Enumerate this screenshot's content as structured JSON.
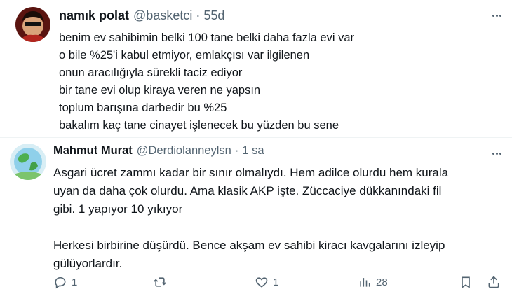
{
  "tweet1": {
    "name": "namık polat",
    "handle": "@basketci",
    "separator": "·",
    "time": "55d",
    "lines": [
      "benim ev sahibimin belki 100 tane belki daha fazla evi var",
      "o bile %25'i kabul etmiyor, emlakçısı var ilgilenen",
      "onun aracılığıyla sürekli taciz ediyor",
      "bir tane evi olup kiraya veren ne yapsın",
      "toplum barışına darbedir bu %25",
      "bakalım kaç tane cinayet işlenecek bu yüzden bu sene"
    ]
  },
  "tweet2": {
    "name": "Mahmut Murat",
    "handle": "@Derdiolanneylsn",
    "separator": "·",
    "time": "1 sa",
    "lines": [
      "Asgari ücret zammı kadar bir sınır olmalıydı. Hem adilce olurdu hem kurala",
      "uyan da daha çok olurdu. Ama klasik AKP işte. Züccaciye dükkanındaki fil",
      "gibi. 1 yapıyor 10 yıkıyor"
    ],
    "lines2": [
      "Herkesi birbirine düşürdü. Bence akşam ev sahibi kiracı kavgalarını izleyip",
      "gülüyorlardır."
    ],
    "actions": {
      "reply_count": "1",
      "retweet_count": "",
      "like_count": "1",
      "views_count": "28"
    }
  },
  "colors": {
    "text": "#0f1419",
    "secondary": "#536471",
    "divider": "#eff3f4"
  },
  "icons": [
    "more-icon",
    "reply-icon",
    "retweet-icon",
    "like-icon",
    "views-icon",
    "bookmark-icon",
    "share-icon"
  ]
}
